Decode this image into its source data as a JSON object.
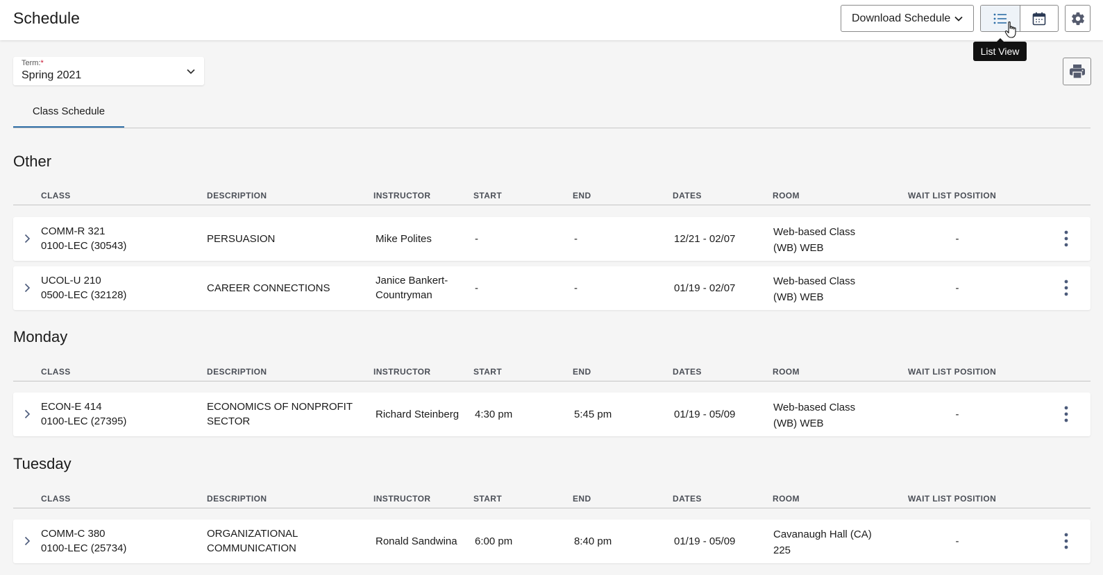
{
  "header": {
    "title": "Schedule",
    "download_label": "Download Schedule",
    "tooltip": "List View"
  },
  "term": {
    "label": "Term:",
    "required_mark": "*",
    "value": "Spring 2021"
  },
  "tabs": [
    {
      "label": "Class Schedule"
    }
  ],
  "columns": [
    "CLASS",
    "DESCRIPTION",
    "INSTRUCTOR",
    "START",
    "END",
    "DATES",
    "ROOM",
    "WAIT LIST POSITION"
  ],
  "sections": [
    {
      "title": "Other",
      "rows": [
        {
          "class_code": "COMM-R 321",
          "class_section": "0100-LEC (30543)",
          "description": "PERSUASION",
          "instructor": "Mike Polites",
          "start": "-",
          "end": "-",
          "dates": "12/21 - 02/07",
          "room_1": "Web-based Class",
          "room_2": "(WB) WEB",
          "wait": "-"
        },
        {
          "class_code": "UCOL-U 210",
          "class_section": "0500-LEC (32128)",
          "description": "CAREER CONNECTIONS",
          "instructor": "Janice Bankert-Countryman",
          "start": "-",
          "end": "-",
          "dates": "01/19 - 02/07",
          "room_1": "Web-based Class",
          "room_2": "(WB) WEB",
          "wait": "-"
        }
      ]
    },
    {
      "title": "Monday",
      "rows": [
        {
          "class_code": "ECON-E 414",
          "class_section": "0100-LEC (27395)",
          "description": "ECONOMICS OF NONPROFIT SECTOR",
          "instructor": "Richard Steinberg",
          "start": "4:30 pm",
          "end": "5:45 pm",
          "dates": "01/19 - 05/09",
          "room_1": "Web-based Class",
          "room_2": "(WB) WEB",
          "wait": "-"
        }
      ]
    },
    {
      "title": "Tuesday",
      "rows": [
        {
          "class_code": "COMM-C 380",
          "class_section": "0100-LEC (25734)",
          "description": "ORGANIZATIONAL COMMUNICATION",
          "instructor": "Ronald Sandwina",
          "start": "6:00 pm",
          "end": "8:40 pm",
          "dates": "01/19 - 05/09",
          "room_1": "Cavanaugh Hall (CA)",
          "room_2": "225",
          "wait": "-"
        }
      ]
    }
  ],
  "icons": {
    "list": "list-icon",
    "calendar": "calendar-icon",
    "settings": "gear-icon",
    "print": "printer-icon",
    "expand": "chevron-right-icon",
    "more": "kebab-menu-icon"
  },
  "colors": {
    "accent": "#2f6fa7",
    "required": "#c8102e",
    "tooltip_bg": "#111111"
  }
}
